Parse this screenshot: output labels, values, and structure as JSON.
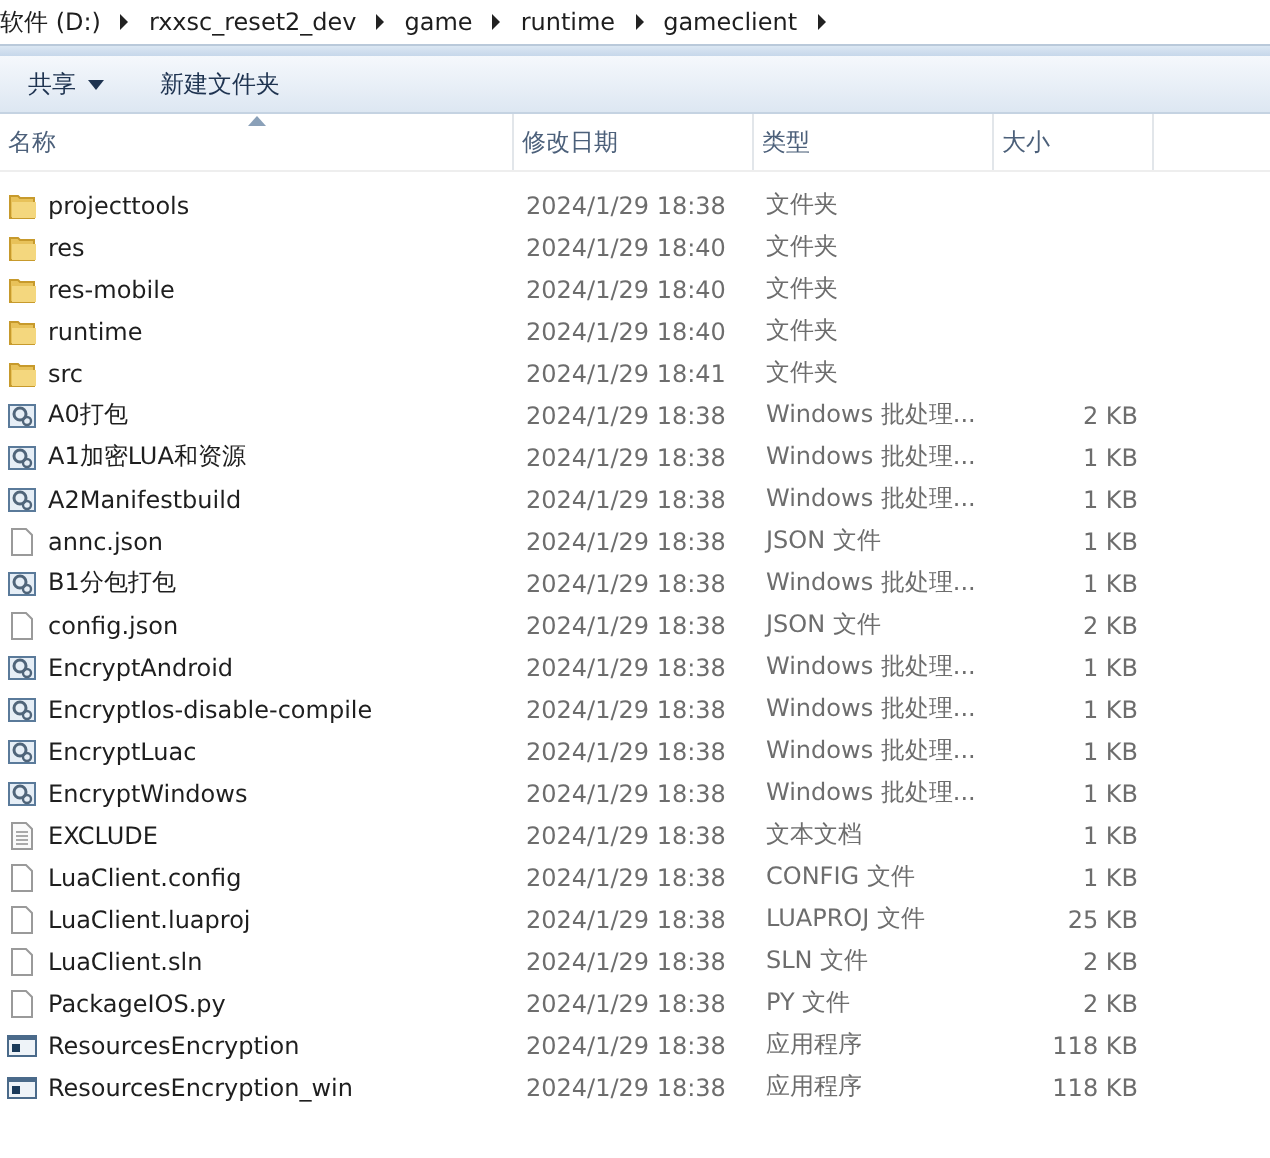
{
  "breadcrumb": [
    "软件 (D:)",
    "rxxsc_reset2_dev",
    "game",
    "runtime",
    "gameclient"
  ],
  "toolbar": [
    {
      "label": "共享",
      "dropdown": true
    },
    {
      "label": "新建文件夹",
      "dropdown": false
    }
  ],
  "columns": [
    {
      "label": "名称",
      "sorted": true
    },
    {
      "label": "修改日期",
      "sorted": false
    },
    {
      "label": "类型",
      "sorted": false
    },
    {
      "label": "大小",
      "sorted": false
    }
  ],
  "rows": [
    {
      "kind": "folder",
      "name": "projecttools",
      "date": "2024/1/29 18:38",
      "type": "文件夹"
    },
    {
      "kind": "folder",
      "name": "res",
      "date": "2024/1/29 18:40",
      "type": "文件夹"
    },
    {
      "kind": "folder",
      "name": "res-mobile",
      "date": "2024/1/29 18:40",
      "type": "文件夹"
    },
    {
      "kind": "folder",
      "name": "runtime",
      "date": "2024/1/29 18:40",
      "type": "文件夹"
    },
    {
      "kind": "folder",
      "name": "src",
      "date": "2024/1/29 18:41",
      "type": "文件夹"
    },
    {
      "kind": "batch",
      "name": "A0打包",
      "date": "2024/1/29 18:38",
      "type": "Windows 批处理...",
      "size": "2 KB"
    },
    {
      "kind": "batch",
      "name": "A1加密LUA和资源",
      "date": "2024/1/29 18:38",
      "type": "Windows 批处理...",
      "size": "1 KB"
    },
    {
      "kind": "batch",
      "name": "A2Manifestbuild",
      "date": "2024/1/29 18:38",
      "type": "Windows 批处理...",
      "size": "1 KB"
    },
    {
      "kind": "file",
      "name": "annc.json",
      "date": "2024/1/29 18:38",
      "type": "JSON 文件",
      "size": "1 KB"
    },
    {
      "kind": "batch",
      "name": "B1分包打包",
      "date": "2024/1/29 18:38",
      "type": "Windows 批处理...",
      "size": "1 KB"
    },
    {
      "kind": "file",
      "name": "config.json",
      "date": "2024/1/29 18:38",
      "type": "JSON 文件",
      "size": "2 KB"
    },
    {
      "kind": "batch",
      "name": "EncryptAndroid",
      "date": "2024/1/29 18:38",
      "type": "Windows 批处理...",
      "size": "1 KB"
    },
    {
      "kind": "batch",
      "name": "EncryptIos-disable-compile",
      "date": "2024/1/29 18:38",
      "type": "Windows 批处理...",
      "size": "1 KB"
    },
    {
      "kind": "batch",
      "name": "EncryptLuac",
      "date": "2024/1/29 18:38",
      "type": "Windows 批处理...",
      "size": "1 KB"
    },
    {
      "kind": "batch",
      "name": "EncryptWindows",
      "date": "2024/1/29 18:38",
      "type": "Windows 批处理...",
      "size": "1 KB"
    },
    {
      "kind": "text",
      "name": "EXCLUDE",
      "date": "2024/1/29 18:38",
      "type": "文本文档",
      "size": "1 KB"
    },
    {
      "kind": "file",
      "name": "LuaClient.config",
      "date": "2024/1/29 18:38",
      "type": "CONFIG 文件",
      "size": "1 KB"
    },
    {
      "kind": "file",
      "name": "LuaClient.luaproj",
      "date": "2024/1/29 18:38",
      "type": "LUAPROJ 文件",
      "size": "25 KB"
    },
    {
      "kind": "file",
      "name": "LuaClient.sln",
      "date": "2024/1/29 18:38",
      "type": "SLN 文件",
      "size": "2 KB"
    },
    {
      "kind": "file",
      "name": "PackageIOS.py",
      "date": "2024/1/29 18:38",
      "type": "PY 文件",
      "size": "2 KB"
    },
    {
      "kind": "app",
      "name": "ResourcesEncryption",
      "date": "2024/1/29 18:38",
      "type": "应用程序",
      "size": "118 KB"
    },
    {
      "kind": "app",
      "name": "ResourcesEncryption_win",
      "date": "2024/1/29 18:38",
      "type": "应用程序",
      "size": "118 KB"
    }
  ]
}
